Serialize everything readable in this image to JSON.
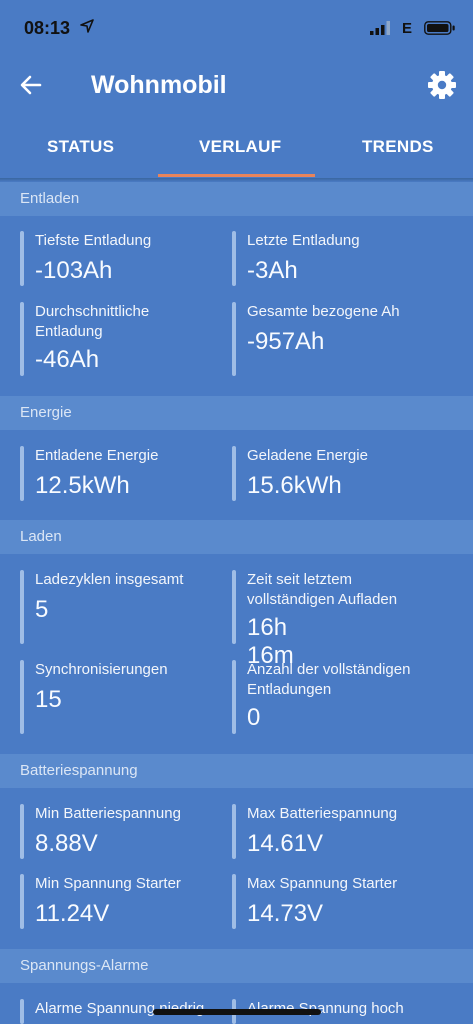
{
  "status_bar": {
    "time": "08:13",
    "network": "E"
  },
  "header": {
    "title": "Wohnmobil"
  },
  "tabs": [
    {
      "label": "STATUS"
    },
    {
      "label": "VERLAUF",
      "selected": true
    },
    {
      "label": "TRENDS"
    }
  ],
  "sections": [
    {
      "title": "Entladen",
      "items": [
        {
          "label": "Tiefste Entladung",
          "value": "-103Ah"
        },
        {
          "label": "Letzte Entladung",
          "value": "-3Ah"
        },
        {
          "label": "Durchschnittliche Entladung",
          "value": "-46Ah"
        },
        {
          "label": "Gesamte bezogene Ah",
          "value": "-957Ah"
        }
      ]
    },
    {
      "title": "Energie",
      "items": [
        {
          "label": "Entladene Energie",
          "value": "12.5kWh"
        },
        {
          "label": "Geladene Energie",
          "value": "15.6kWh"
        }
      ]
    },
    {
      "title": "Laden",
      "items": [
        {
          "label": "Ladezyklen insgesamt",
          "value": "5"
        },
        {
          "label": "Zeit seit letztem vollständigen Aufladen",
          "value": "16h 16m"
        },
        {
          "label": "Synchronisierungen",
          "value": "15"
        },
        {
          "label": "Anzahl der vollständigen Entladungen",
          "value": "0"
        }
      ]
    },
    {
      "title": "Batteriespannung",
      "items": [
        {
          "label": "Min Batteriespannung",
          "value": "8.88V"
        },
        {
          "label": "Max Batteriespannung",
          "value": "14.61V"
        },
        {
          "label": "Min Spannung Starter",
          "value": "11.24V"
        },
        {
          "label": "Max Spannung Starter",
          "value": "14.73V"
        }
      ]
    },
    {
      "title": "Spannungs-Alarme",
      "items": [
        {
          "label": "Alarme Spannung niedrig",
          "value": ""
        },
        {
          "label": "Alarme Spannung hoch",
          "value": ""
        }
      ]
    }
  ],
  "colors": {
    "background": "#4a7bc5",
    "section_header": "#5a8acd",
    "tab_indicator": "#e8845a"
  }
}
